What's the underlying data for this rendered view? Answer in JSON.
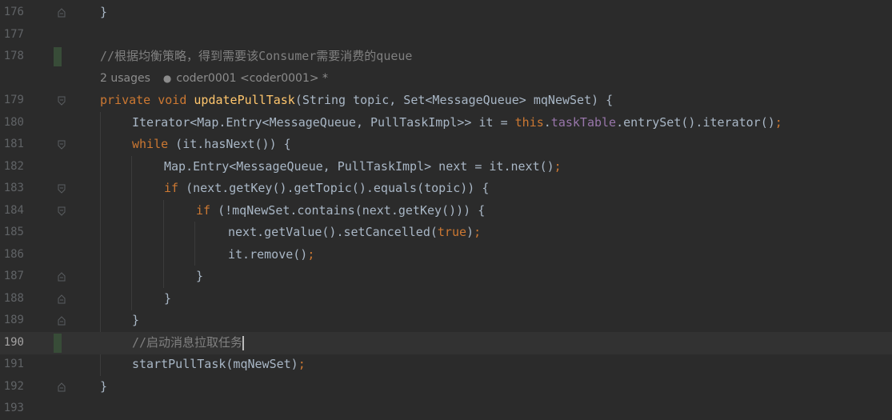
{
  "editor": {
    "line_numbers": [
      "176",
      "177",
      "178",
      "179",
      "180",
      "181",
      "182",
      "183",
      "184",
      "185",
      "186",
      "187",
      "188",
      "189",
      "190",
      "191",
      "192",
      "193"
    ],
    "current_line": "190",
    "hint": {
      "usages": "2 usages",
      "author": "coder0001 <coder0001> *"
    },
    "code": {
      "l176": "}",
      "l178": "//根据均衡策略，得到需要该Consumer需要消费的queue",
      "l179": {
        "kw1": "private",
        "kw2": "void",
        "fn": "updatePullTask",
        "rest": "(String topic, Set<MessageQueue> mqNewSet) {"
      },
      "l180": {
        "a": "Iterator<Map.Entry<MessageQueue, PullTaskImpl>> it = ",
        "kw": "this",
        "b": ".",
        "field": "taskTable",
        "c": ".entrySet().iterator()",
        "semi": ";"
      },
      "l181": {
        "kw": "while",
        "rest": " (it.hasNext()) {"
      },
      "l182": {
        "a": "Map.Entry<MessageQueue, PullTaskImpl> next = it.next()",
        "semi": ";"
      },
      "l183": {
        "kw": "if",
        "rest": " (next.getKey().getTopic().equals(topic)) {"
      },
      "l184": {
        "kw": "if",
        "rest": " (!mqNewSet.contains(next.getKey())) {"
      },
      "l185": {
        "a": "next.getValue().setCancelled(",
        "kw": "true",
        "b": ")",
        "semi": ";"
      },
      "l186": {
        "a": "it.remove()",
        "semi": ";"
      },
      "l187": "}",
      "l188": "}",
      "l189": "}",
      "l190": "//启动消息拉取任务",
      "l191": {
        "a": "startPullTask(mqNewSet)",
        "semi": ";"
      },
      "l192": "}"
    }
  },
  "colors": {
    "background": "#2b2b2b",
    "current_line": "#323232",
    "keyword": "#cc7832",
    "function": "#ffc66d",
    "comment": "#808080",
    "field": "#9876aa",
    "text": "#a9b7c6",
    "line_number": "#606366"
  },
  "icons": [
    "fold-icon",
    "user-icon",
    "change-marker"
  ]
}
